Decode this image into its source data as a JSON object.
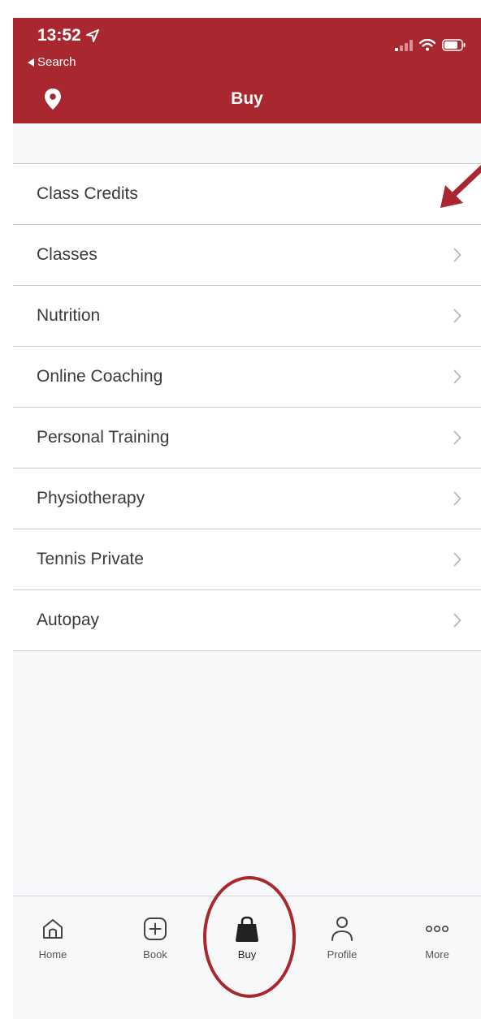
{
  "status_bar": {
    "time": "13:52",
    "back_label": "Search"
  },
  "header": {
    "title": "Buy"
  },
  "menu": {
    "items": [
      {
        "label": "Class Credits",
        "has_chevron": false
      },
      {
        "label": "Classes",
        "has_chevron": true
      },
      {
        "label": "Nutrition",
        "has_chevron": true
      },
      {
        "label": "Online Coaching",
        "has_chevron": true
      },
      {
        "label": "Personal Training",
        "has_chevron": true
      },
      {
        "label": "Physiotherapy",
        "has_chevron": true
      },
      {
        "label": "Tennis Private",
        "has_chevron": true
      },
      {
        "label": "Autopay",
        "has_chevron": true
      }
    ]
  },
  "tab_bar": {
    "tabs": [
      {
        "label": "Home",
        "icon": "home-icon"
      },
      {
        "label": "Book",
        "icon": "plus-square-icon"
      },
      {
        "label": "Buy",
        "icon": "shopping-bag-icon",
        "selected": true
      },
      {
        "label": "Profile",
        "icon": "person-icon"
      },
      {
        "label": "More",
        "icon": "ellipsis-icon"
      }
    ]
  },
  "colors": {
    "brand": "#a9272e",
    "background": "#f7f8fa",
    "separator": "#c9c9cc",
    "text": "#3a3a3c",
    "chevron": "#b8b8bc"
  }
}
